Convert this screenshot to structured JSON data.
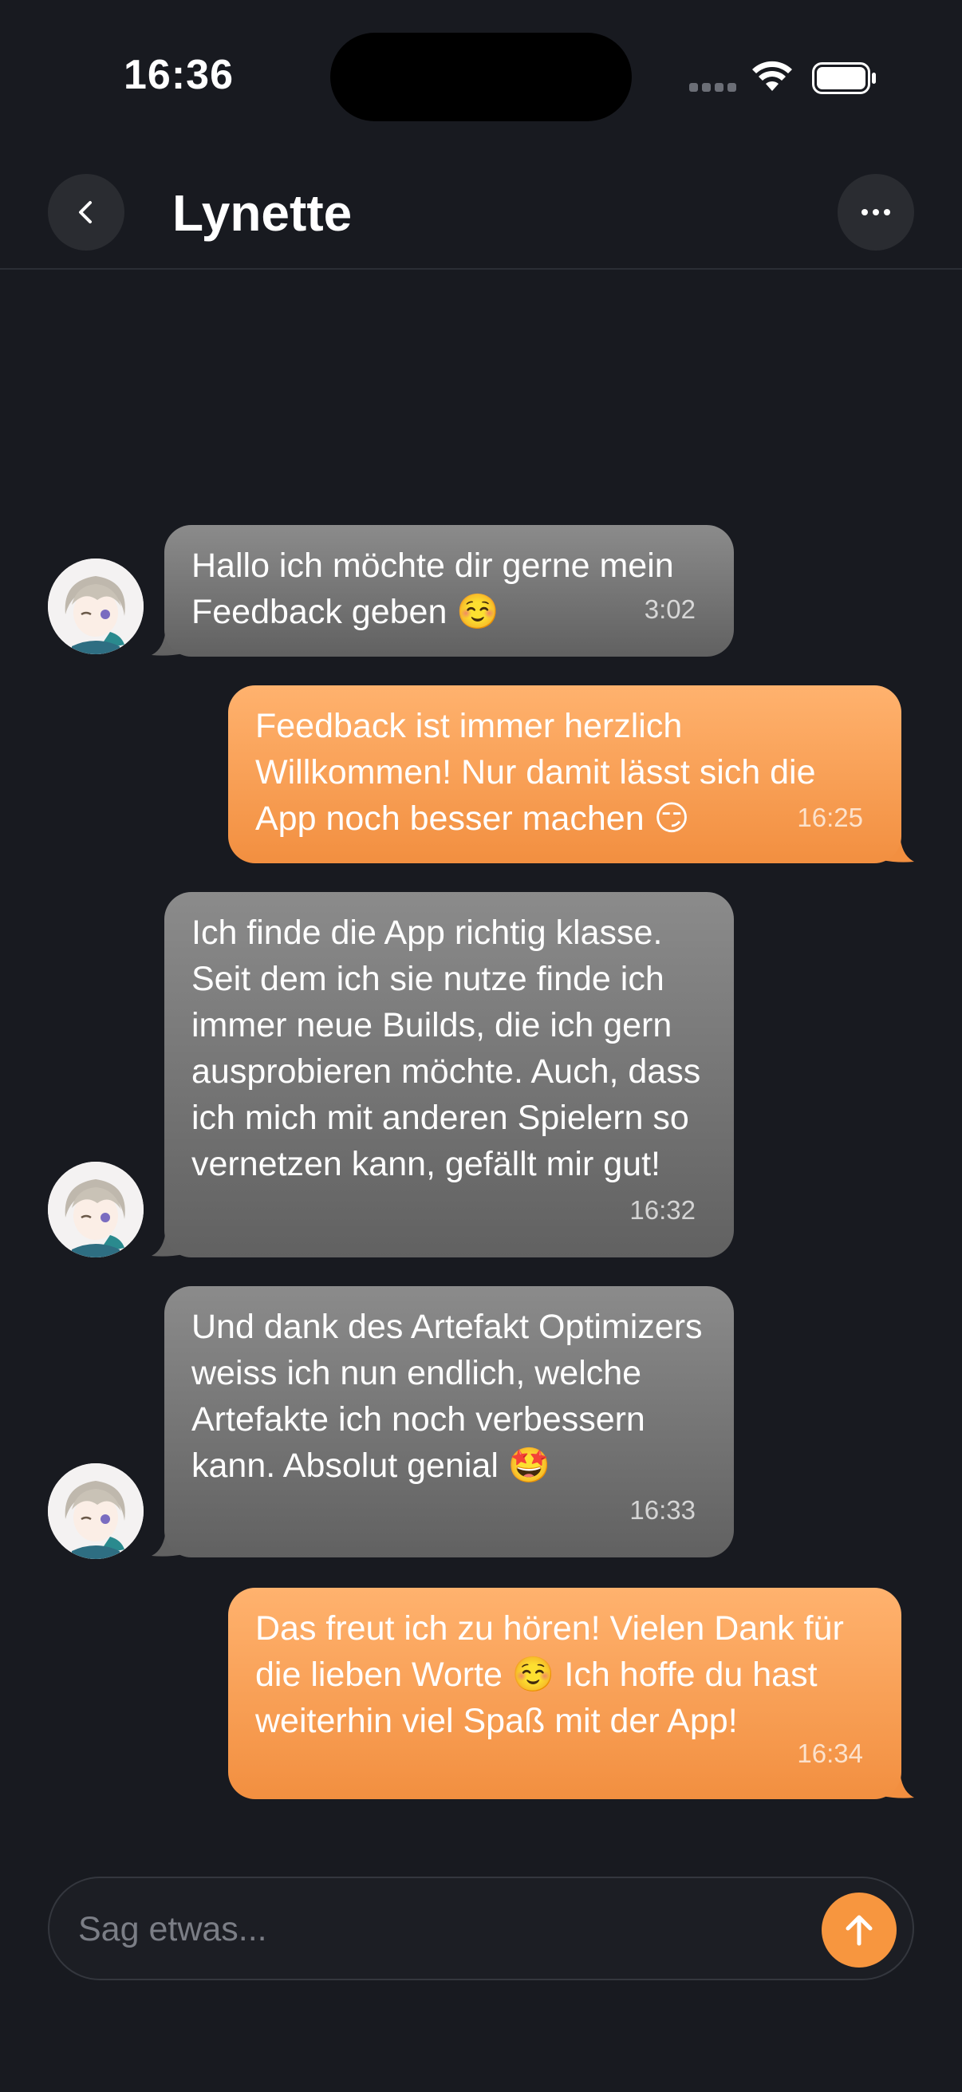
{
  "status_bar": {
    "time": "16:36"
  },
  "header": {
    "title": "Lynette",
    "back_icon": "chevron-left-icon",
    "more_icon": "ellipsis-icon"
  },
  "messages": [
    {
      "direction": "incoming",
      "text": "Hallo ich möchte dir gerne mein Feedback geben ☺️",
      "time": "3:02"
    },
    {
      "direction": "outgoing",
      "text": "Feedback ist immer herzlich Willkommen! Nur damit lässt sich die App noch besser machen 😏",
      "time": "16:25"
    },
    {
      "direction": "incoming",
      "text": "Ich finde die App richtig klasse. Seit dem ich sie nutze finde ich immer neue Builds, die ich gern ausprobieren möchte. Auch, dass ich mich mit anderen Spielern so vernetzen kann, gefällt mir gut!",
      "time": "16:32"
    },
    {
      "direction": "incoming",
      "text": "Und dank des Artefakt Optimizers weiss ich nun endlich, welche Artefakte ich noch verbessern kann. Absolut genial 🤩",
      "time": "16:33"
    },
    {
      "direction": "outgoing",
      "text": "Das freut ich zu hören! Vielen Dank für die lieben Worte ☺️ Ich hoffe du hast weiterhin viel Spaß mit der App!",
      "time": "16:34"
    }
  ],
  "composer": {
    "placeholder": "Sag etwas...",
    "send_icon": "arrow-up-icon"
  },
  "colors": {
    "background": "#181a20",
    "incoming_bubble": "#787878",
    "outgoing_bubble": "#f7963f",
    "accent": "#f7963f"
  }
}
